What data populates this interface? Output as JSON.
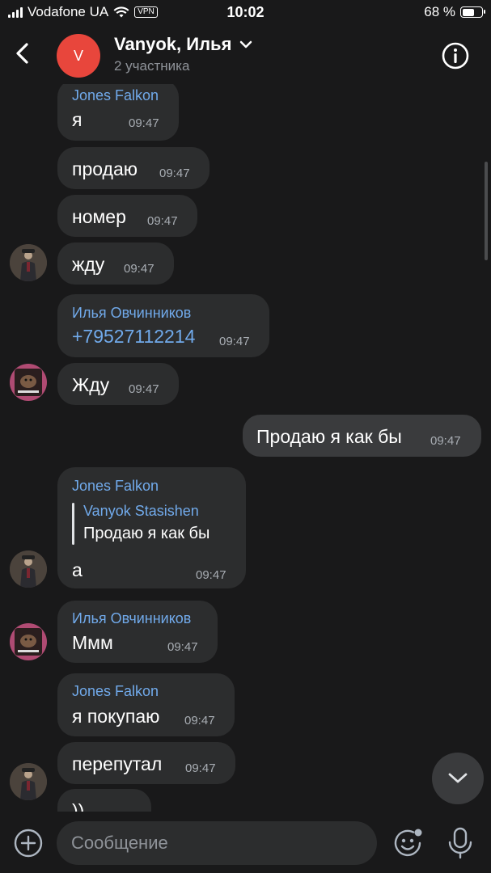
{
  "status_bar": {
    "carrier": "Vodafone UA",
    "vpn": "VPN",
    "time": "10:02",
    "battery": "68 %",
    "battery_level": 0.68
  },
  "header": {
    "avatar_letter": "V",
    "title": "Vanyok, Илья",
    "subtitle": "2 участника"
  },
  "messages": [
    {
      "sender": "Jones Falkon",
      "text": "я",
      "time": "09:47"
    },
    {
      "text": "продаю",
      "time": "09:47"
    },
    {
      "text": "номер",
      "time": "09:47"
    },
    {
      "text": "жду",
      "time": "09:47"
    },
    {
      "sender": "Илья Овчинников",
      "text": "+79527112214",
      "time": "09:47"
    },
    {
      "text": "Жду",
      "time": "09:47"
    },
    {
      "text": "Продаю я как бы",
      "time": "09:47",
      "outgoing": true
    },
    {
      "sender": "Jones Falkon",
      "reply_name": "Vanyok Stasishen",
      "reply_text": "Продаю я как бы",
      "text": "а",
      "time": "09:47"
    },
    {
      "sender": "Илья Овчинников",
      "text": "Ммм",
      "time": "09:47"
    },
    {
      "sender": "Jones Falkon",
      "text": "я покупаю",
      "time": "09:47"
    },
    {
      "text": "перепутал",
      "time": "09:47"
    },
    {
      "text": "))"
    }
  ],
  "composer": {
    "placeholder": "Сообщение"
  },
  "icons": {
    "back": "chevron-left-icon",
    "dropdown": "chevron-down-icon",
    "info": "info-icon",
    "scroll_down": "chevron-down-icon",
    "attach": "plus-circle-icon",
    "sticker": "smiley-icon",
    "mic": "microphone-icon"
  },
  "colors": {
    "background": "#19191a",
    "bubble": "#2c2d2e",
    "sender": "#71aaeb",
    "avatar": "#e8463c"
  }
}
